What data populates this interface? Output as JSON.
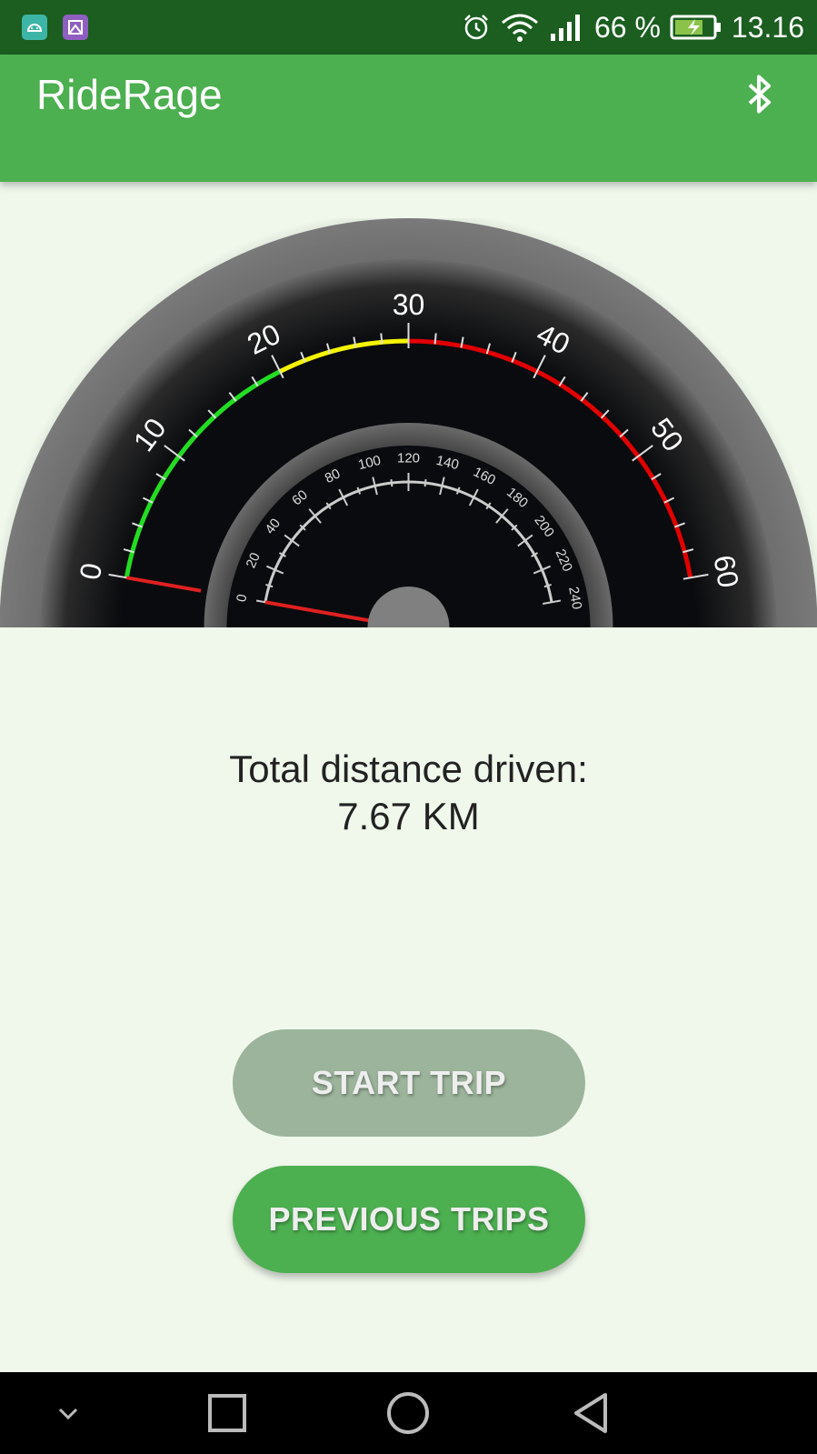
{
  "status_bar": {
    "battery_percent": "66 %",
    "time": "13.16",
    "icons": [
      "android-debug-icon",
      "image-icon",
      "alarm-icon",
      "wifi-icon",
      "signal-icon",
      "battery-charging-icon"
    ]
  },
  "app_bar": {
    "title": "RideRage",
    "action_icon": "bluetooth-icon"
  },
  "gauge": {
    "outer_scale": {
      "min": 0,
      "max": 60,
      "labels": [
        "0",
        "10",
        "20",
        "30",
        "40",
        "50",
        "60"
      ],
      "value": 0
    },
    "inner_scale": {
      "min": 0,
      "max": 240,
      "labels": [
        "0",
        "20",
        "40",
        "60",
        "80",
        "100",
        "120",
        "140",
        "160",
        "180",
        "200",
        "220",
        "240"
      ],
      "value": 0
    },
    "colors": {
      "green": "#22dd22",
      "yellow": "#f4f400",
      "red": "#e00000",
      "needle": "#e02020"
    }
  },
  "distance": {
    "label": "Total distance driven:",
    "value": "7.67 KM"
  },
  "buttons": {
    "start_trip": "START TRIP",
    "previous_trips": "PREVIOUS TRIPS"
  },
  "nav_bar": {
    "icons": [
      "chevron-down-icon",
      "recents-icon",
      "home-icon",
      "back-icon"
    ]
  }
}
